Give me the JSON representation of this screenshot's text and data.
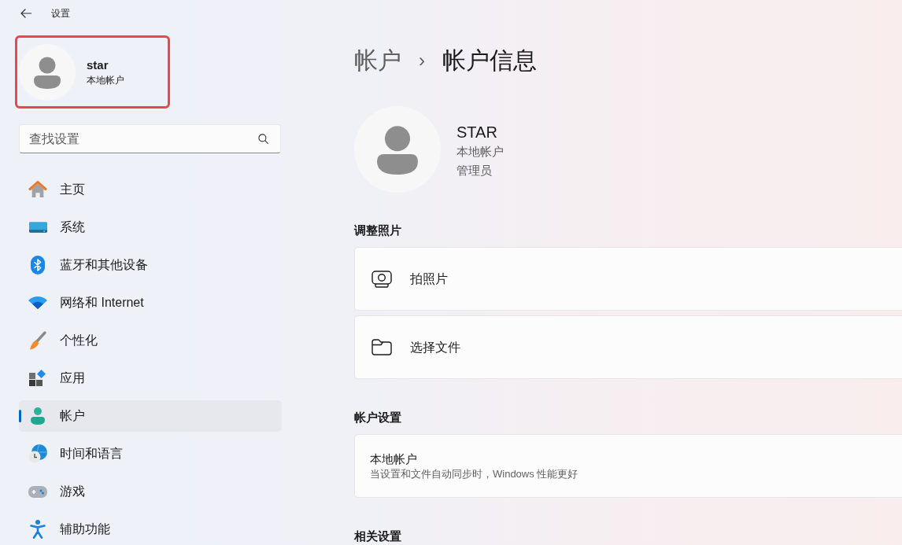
{
  "window": {
    "title": "设置"
  },
  "profile": {
    "name": "star",
    "account_type": "本地帐户",
    "highlighted": true
  },
  "search": {
    "placeholder": "查找设置"
  },
  "sidebar": {
    "items": [
      {
        "label": "主页",
        "selected": false
      },
      {
        "label": "系统",
        "selected": false
      },
      {
        "label": "蓝牙和其他设备",
        "selected": false
      },
      {
        "label": "网络和 Internet",
        "selected": false
      },
      {
        "label": "个性化",
        "selected": false
      },
      {
        "label": "应用",
        "selected": false
      },
      {
        "label": "帐户",
        "selected": true
      },
      {
        "label": "时间和语言",
        "selected": false
      },
      {
        "label": "游戏",
        "selected": false
      },
      {
        "label": "辅助功能",
        "selected": false
      }
    ]
  },
  "breadcrumb": {
    "parent": "帐户",
    "separator": "›",
    "current": "帐户信息"
  },
  "account": {
    "name": "STAR",
    "account_type": "本地帐户",
    "role": "管理员"
  },
  "sections": [
    {
      "heading": "调整照片",
      "cards": [
        {
          "kind": "action",
          "label": "拍照片"
        },
        {
          "kind": "action",
          "label": "选择文件"
        }
      ]
    },
    {
      "heading": "帐户设置",
      "cards": [
        {
          "kind": "info",
          "title": "本地帐户",
          "description": "当设置和文件自动同步时，Windows 性能更好"
        }
      ]
    },
    {
      "heading": "相关设置"
    }
  ]
}
